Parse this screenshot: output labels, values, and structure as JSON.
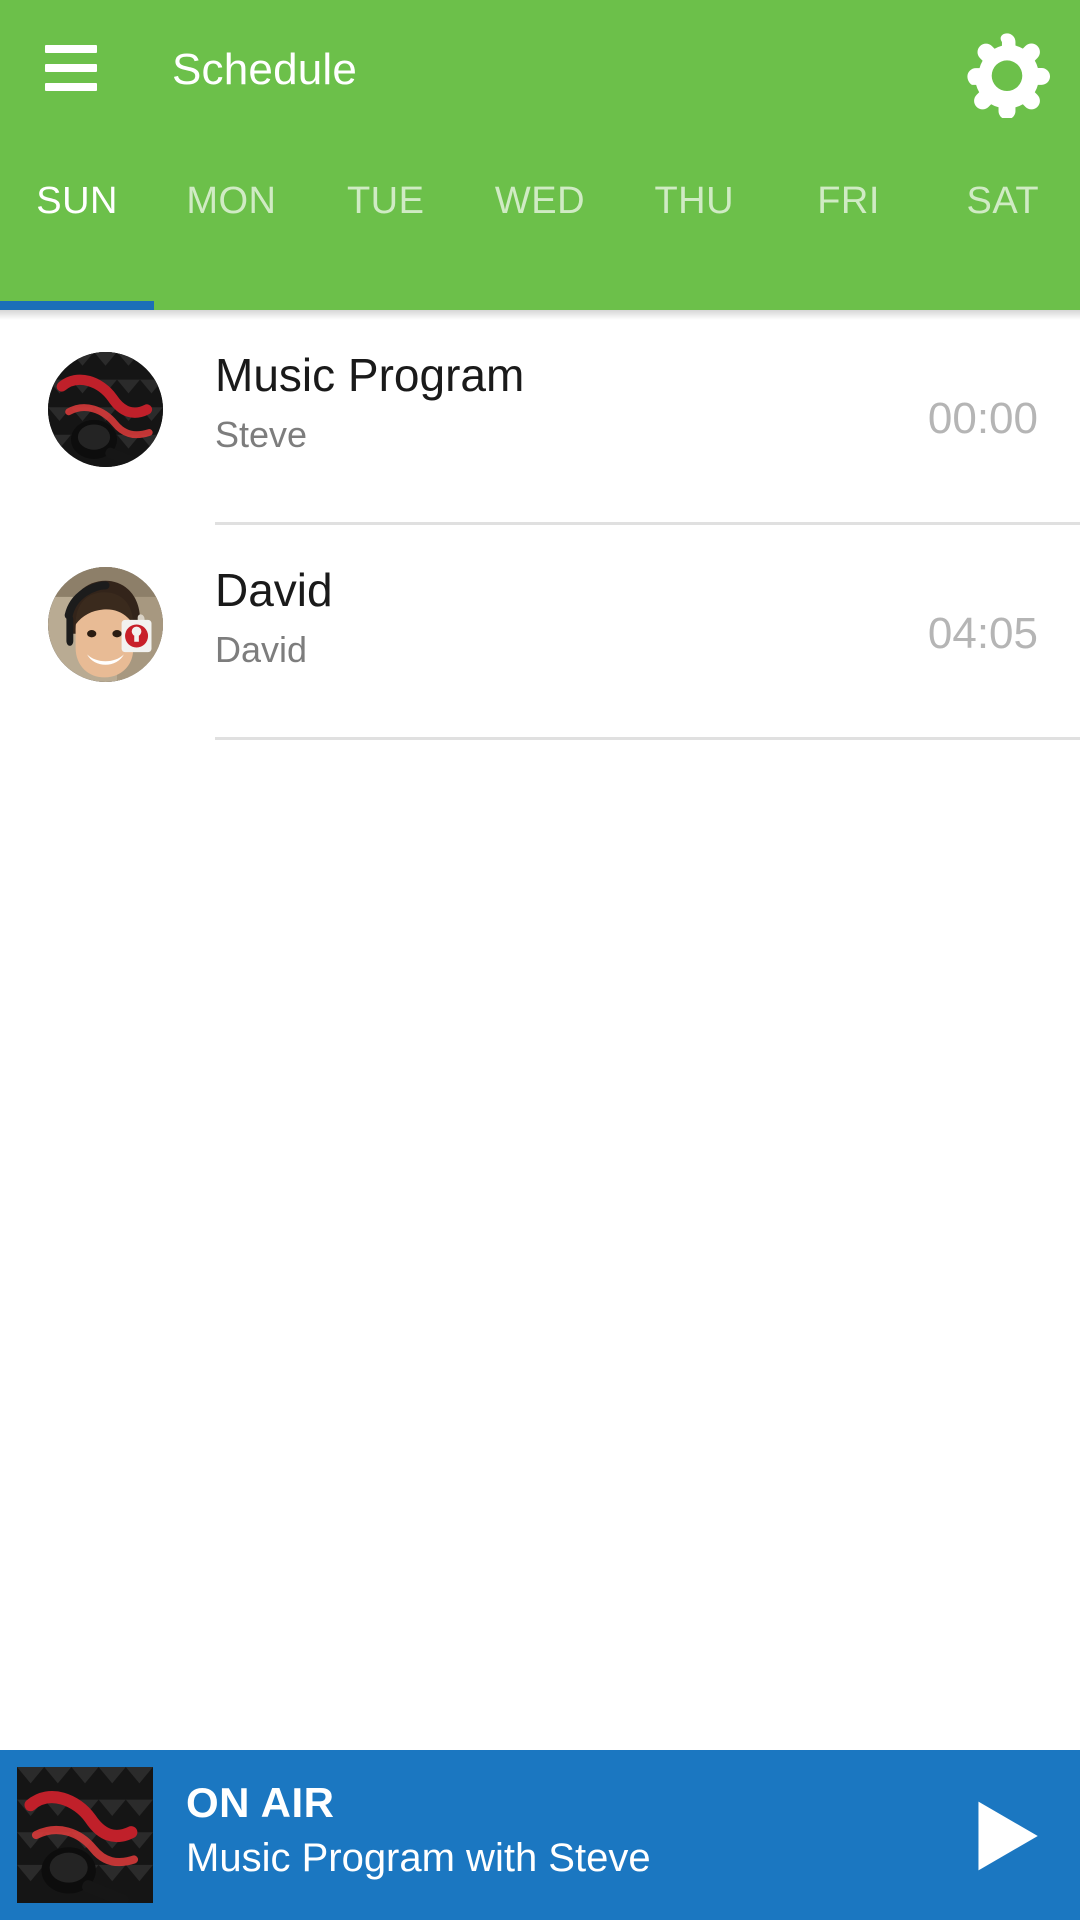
{
  "header": {
    "title": "Schedule",
    "background_color": "#6CC04A",
    "menu_icon": "hamburger-menu-icon",
    "settings_icon": "gear-icon"
  },
  "tabs": {
    "active_index": 0,
    "indicator_color": "#1B6FB8",
    "items": [
      {
        "label": "SUN"
      },
      {
        "label": "MON"
      },
      {
        "label": "TUE"
      },
      {
        "label": "WED"
      },
      {
        "label": "THU"
      },
      {
        "label": "FRI"
      },
      {
        "label": "SAT"
      }
    ]
  },
  "schedule": {
    "rows": [
      {
        "title": "Music Program",
        "host": "Steve",
        "time": "00:00",
        "avatar": "studio-microphone-photo"
      },
      {
        "title": "David",
        "host": "David",
        "time": "04:05",
        "avatar": "dj-headphones-portrait-photo"
      }
    ]
  },
  "player": {
    "status_label": "ON AIR",
    "now_playing": "Music Program with Steve",
    "thumbnail": "studio-microphone-photo",
    "play_icon": "play-triangle-icon",
    "background_color": "#1B77C1"
  }
}
